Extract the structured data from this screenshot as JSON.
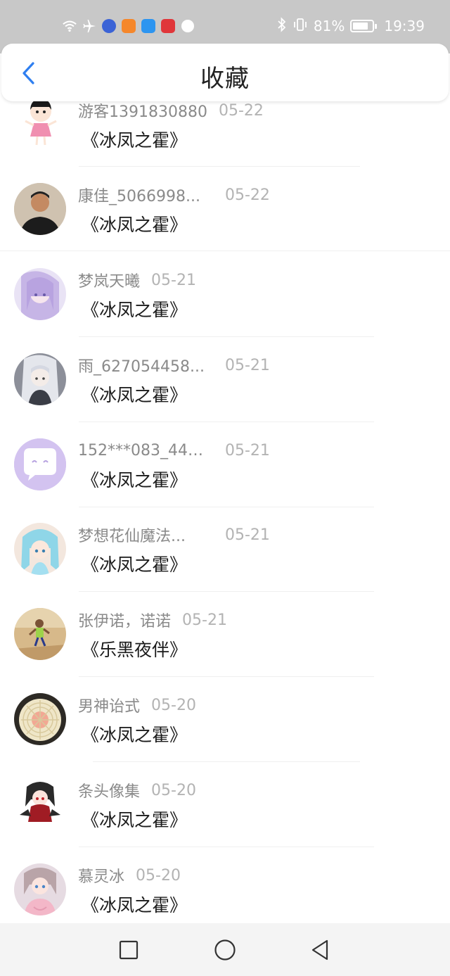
{
  "status_bar": {
    "battery_percent": "81%",
    "battery_level": 0.81,
    "time": "19:39",
    "icons": [
      "wifi-icon",
      "airplane-icon",
      "music-app-icon",
      "video-app-icon",
      "search-app-icon",
      "huawei-app-icon",
      "browser-app-icon",
      "bluetooth-icon",
      "vibrate-icon",
      "battery-icon"
    ]
  },
  "header": {
    "title": "收藏",
    "back_icon": "chevron-left-icon"
  },
  "items": [
    {
      "username": "游客1391830880",
      "date": "05-22",
      "book": "《冰凤之霍》"
    },
    {
      "username": "康佳_5066998...",
      "date": "05-22",
      "book": "《冰凤之霍》"
    },
    {
      "username": "梦岚天曦",
      "date": "05-21",
      "book": "《冰凤之霍》"
    },
    {
      "username": "雨_627054458...",
      "date": "05-21",
      "book": "《冰凤之霍》"
    },
    {
      "username": "152***083_441...",
      "date": "05-21",
      "book": "《冰凤之霍》"
    },
    {
      "username": "梦想花仙魔法...",
      "date": "05-21",
      "book": "《冰凤之霍》"
    },
    {
      "username": "张伊诺，诺诺",
      "date": "05-21",
      "book": "《乐黑夜伴》"
    },
    {
      "username": "男神诒式",
      "date": "05-20",
      "book": "《冰凤之霍》"
    },
    {
      "username": "条头像集",
      "date": "05-20",
      "book": "《冰凤之霍》"
    },
    {
      "username": "慕灵冰",
      "date": "05-20",
      "book": "《冰凤之霍》"
    }
  ],
  "navbar": {
    "icons": [
      "square-recent-icon",
      "circle-home-icon",
      "triangle-back-icon"
    ]
  },
  "colors": {
    "status_bar_bg": "#c8c8c8",
    "accent_blue": "#2f7ff0",
    "username": "#8a8a8a",
    "date": "#b3b3b3",
    "book_title": "#1a1a1a"
  }
}
